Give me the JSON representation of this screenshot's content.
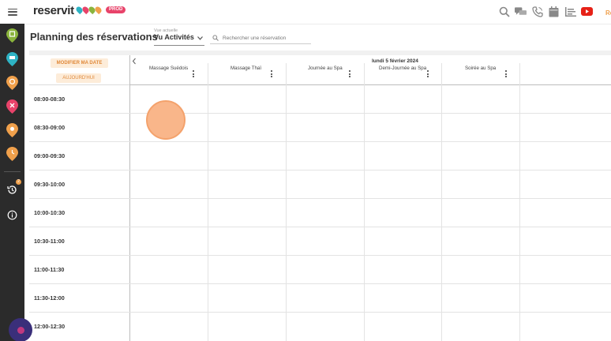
{
  "header": {
    "brand": "reservit",
    "env_badge": "PROD",
    "truncated_text": "Re",
    "icons": [
      "search-icon",
      "chat-icon",
      "phone-icon",
      "calendar-icon",
      "list-icon",
      "youtube-icon"
    ]
  },
  "rail": {
    "items": [
      "pin-green-icon",
      "pin-teal-icon",
      "pin-orange-icon",
      "pin-red-icon",
      "pin-orange-2-icon",
      "pin-orange-3-icon",
      "history-icon",
      "info-icon"
    ],
    "history_badge": "2"
  },
  "page": {
    "title": "Planning des réservations",
    "view": {
      "caption": "Vue actuelle",
      "value": "Vu Activités"
    },
    "search": {
      "placeholder": "Rechercher une réservation"
    }
  },
  "planning": {
    "modify_date_label": "MODIFIER MA DATE",
    "today_label": "AUJOURD'HUI",
    "date": "lundi 5 février 2024",
    "activities": [
      "Massage Suédois",
      "Massage Thaï",
      "Journée au Spa",
      "Demi-Journée au Spa",
      "Soirée au Spa"
    ],
    "time_slots": [
      "08:00-08:30",
      "08:30-09:00",
      "09:00-09:30",
      "09:30-10:00",
      "10:00-10:30",
      "10:30-11:00",
      "11:00-11:30",
      "11:30-12:00",
      "12:00-12:30"
    ]
  },
  "colors": {
    "accent": "#f0a04b",
    "rail": "#2b2b2b",
    "prod": "#e8436a"
  }
}
